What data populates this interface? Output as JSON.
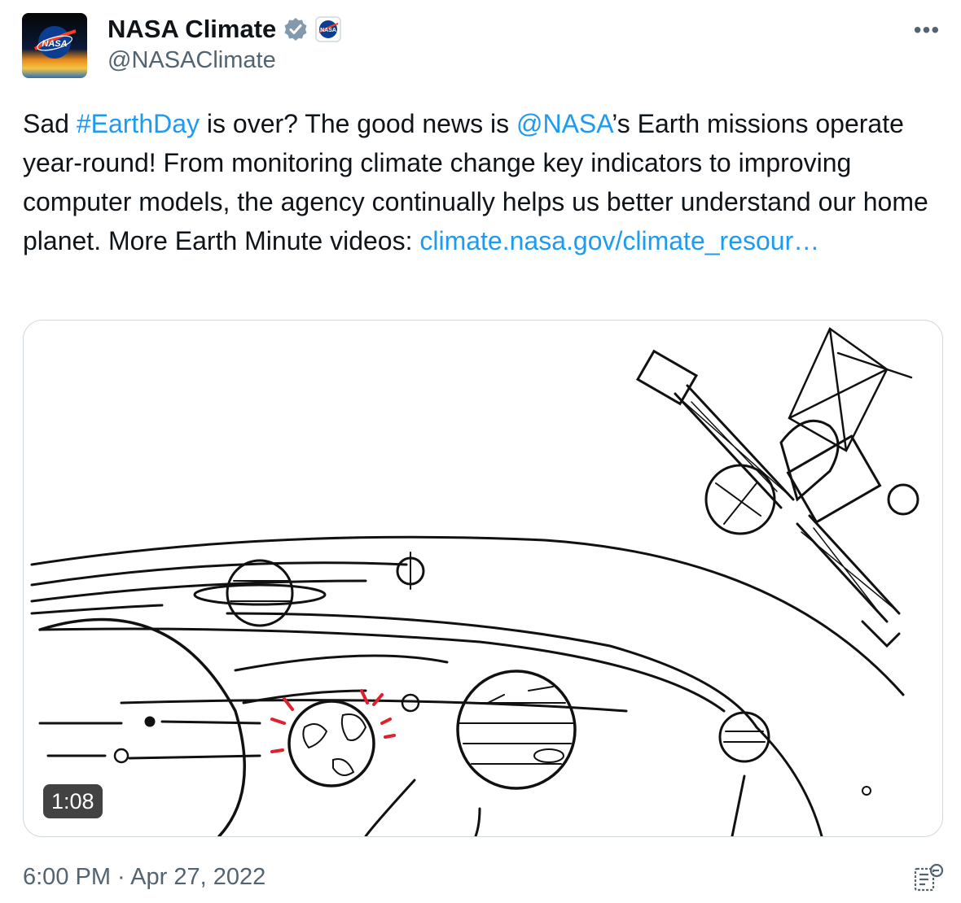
{
  "author": {
    "display_name": "NASA Climate",
    "handle": "@NASAClimate",
    "avatar_icon": "nasa-meatball-logo",
    "verified_icon": "verified-badge-icon",
    "affiliation_icon": "nasa-affiliate-badge-icon"
  },
  "actions": {
    "more_label": "•••"
  },
  "tweet": {
    "text_1": "Sad ",
    "hashtag": "#EarthDay",
    "text_2": " is over? The good news is ",
    "mention": "@NASA",
    "text_3": "’s Earth missions operate year-round! From monitoring climate change key indicators to improving computer models, the agency continually helps us better understand our home planet. More Earth Minute videos: ",
    "link": "climate.nasa.gov/climate_resour…"
  },
  "media": {
    "type": "video",
    "duration": "1:08"
  },
  "timestamp": "6:00 PM · Apr 27, 2022",
  "colors": {
    "link": "#1d9bf0",
    "text": "#0f1419",
    "secondary": "#536471",
    "border": "#cfd9de",
    "accent_red": "#e0202a"
  }
}
